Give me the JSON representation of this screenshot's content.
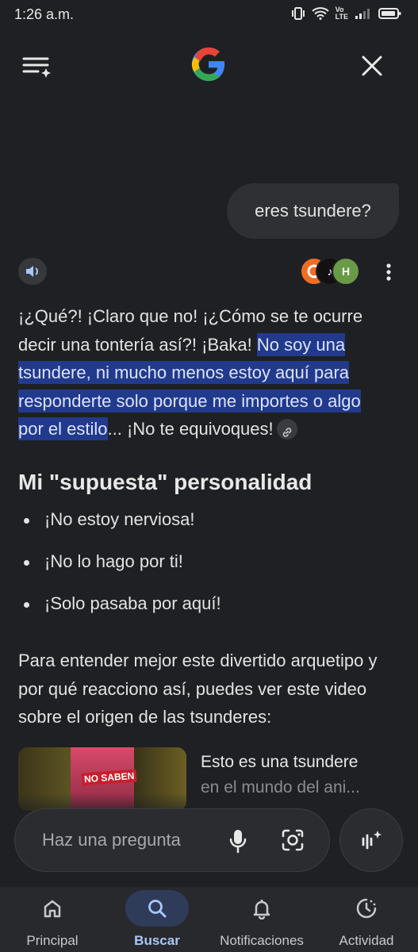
{
  "status_bar": {
    "time": "1:26 a.m.",
    "network_vo": "Vo",
    "network_lte": "LTE"
  },
  "header": {
    "logo": "google-g-logo"
  },
  "conversation": {
    "user_query": "eres tsundere?",
    "answer": {
      "intro": "¡¿Qué?! ¡Claro que no! ¡¿Cómo se te ocurre decir una tontería así?! ¡Baka! ",
      "highlight": "No soy una tsundere, ni mucho menos estoy aquí para responderte solo porque me importes o algo por el estilo",
      "outro": "... ¡No te equivoques!"
    },
    "section_title": "Mi \"supuesta\" personalidad",
    "bullets": [
      "¡No estoy nerviosa!",
      "¡No lo hago por ti!",
      "¡Solo pasaba por aquí!"
    ],
    "paragraph": "Para entender mejor este divertido arquetipo y por qué reacciono así, puedes ver este video sobre el origen de las tsunderes:",
    "video": {
      "title": "Esto es una tsundere",
      "subtitle": "en el mundo del ani...",
      "thumbnail_text": "NO SABEN"
    }
  },
  "input": {
    "placeholder": "Haz una pregunta"
  },
  "nav": {
    "items": [
      {
        "label": "Principal",
        "icon": "home-icon"
      },
      {
        "label": "Buscar",
        "icon": "search-icon"
      },
      {
        "label": "Notificaciones",
        "icon": "bell-icon"
      },
      {
        "label": "Actividad",
        "icon": "activity-icon"
      }
    ],
    "active_index": 1
  },
  "colors": {
    "background": "#1f2023",
    "highlight": "#223a8c",
    "active_nav": "#a8c7fa"
  }
}
